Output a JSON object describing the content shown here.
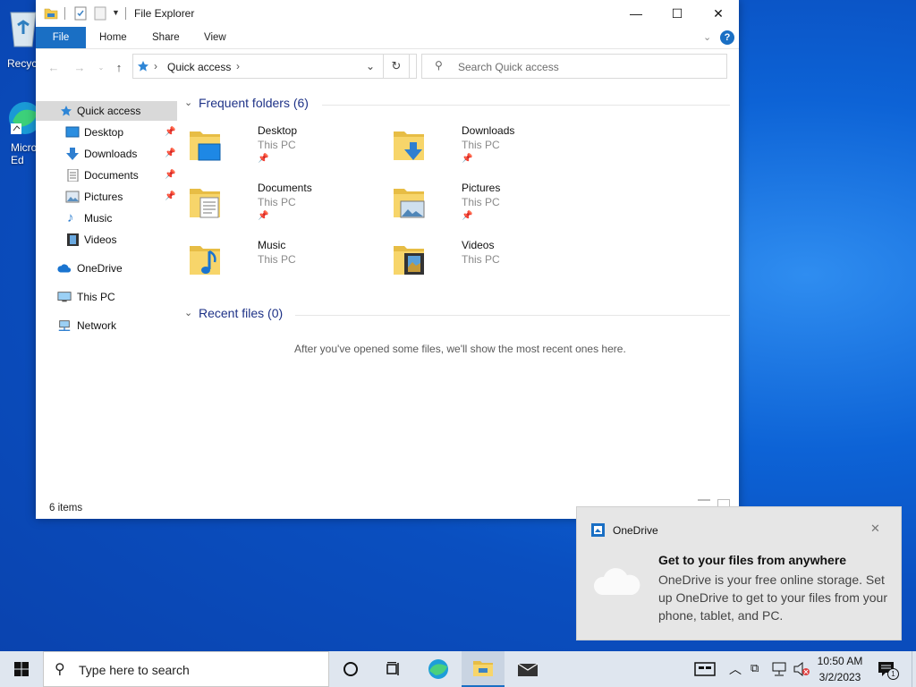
{
  "desktop": {
    "icons": [
      {
        "label": "Recycle Bin",
        "visible_label": "Recyc"
      },
      {
        "label": "Microsoft Edge",
        "visible_label": "Micro Ed"
      }
    ]
  },
  "window": {
    "title": "File Explorer",
    "controls": {
      "minimize": "—",
      "maximize": "☐",
      "close": "✕"
    },
    "ribbon_tabs": [
      "File",
      "Home",
      "Share",
      "View"
    ],
    "address": {
      "location": "Quick access"
    },
    "search": {
      "placeholder": "Search Quick access"
    },
    "nav": {
      "quick_access": "Quick access",
      "items": [
        {
          "label": "Desktop",
          "pinned": true
        },
        {
          "label": "Downloads",
          "pinned": true
        },
        {
          "label": "Documents",
          "pinned": true
        },
        {
          "label": "Pictures",
          "pinned": true
        },
        {
          "label": "Music",
          "pinned": false
        },
        {
          "label": "Videos",
          "pinned": false
        }
      ],
      "onedrive": "OneDrive",
      "this_pc": "This PC",
      "network": "Network"
    },
    "frequent": {
      "header": "Frequent folders (6)",
      "folders": [
        {
          "name": "Desktop",
          "location": "This PC",
          "pinned": true
        },
        {
          "name": "Downloads",
          "location": "This PC",
          "pinned": true
        },
        {
          "name": "Documents",
          "location": "This PC",
          "pinned": true
        },
        {
          "name": "Pictures",
          "location": "This PC",
          "pinned": true
        },
        {
          "name": "Music",
          "location": "This PC",
          "pinned": false
        },
        {
          "name": "Videos",
          "location": "This PC",
          "pinned": false
        }
      ]
    },
    "recent": {
      "header": "Recent files (0)",
      "empty_message": "After you've opened some files, we'll show the most recent ones here."
    },
    "status": "6 items"
  },
  "toast": {
    "app": "OneDrive",
    "title": "Get to your files from anywhere",
    "body": "OneDrive is your free online storage. Set up OneDrive to get to your files from your phone, tablet, and PC."
  },
  "taskbar": {
    "search_placeholder": "Type here to search",
    "time": "10:50 AM",
    "date": "3/2/2023",
    "notification_count": "1"
  },
  "colors": {
    "accent": "#1a6fc4",
    "group_header": "#1e3287",
    "taskbar": "#dfe6ef",
    "toast_bg": "#e6e6e6"
  }
}
